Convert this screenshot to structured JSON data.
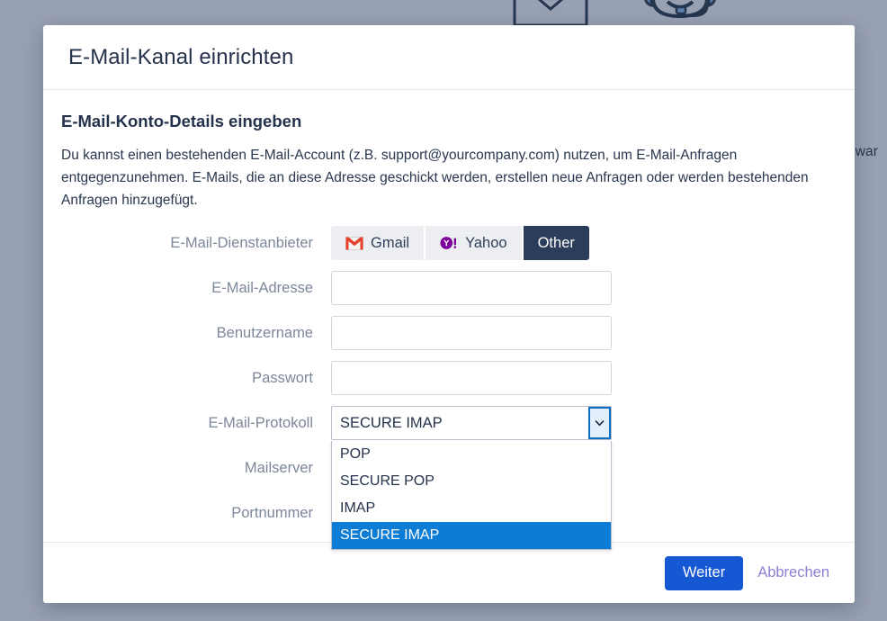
{
  "backdrop": {
    "clipped_text": "nwar",
    "decorations": [
      {
        "name": "envelope-illustration"
      },
      {
        "name": "support-agent-illustration"
      }
    ]
  },
  "modal": {
    "title": "E-Mail-Kanal einrichten",
    "section_heading": "E-Mail-Konto-Details eingeben",
    "intro_text": "Du kannst einen bestehenden E-Mail-Account (z.B. support@yourcompany.com) nutzen, um E-Mail-Anfragen entgegenzunehmen. E-Mails, die an diese Adresse geschickt werden, erstellen neue Anfragen oder werden bestehenden Anfragen hinzugefügt.",
    "form": {
      "provider": {
        "label": "E-Mail-Dienstanbieter",
        "options": [
          {
            "label": "Gmail",
            "icon": "gmail-icon",
            "selected": false
          },
          {
            "label": "Yahoo",
            "icon": "yahoo-icon",
            "selected": false
          },
          {
            "label": "Other",
            "icon": "",
            "selected": true
          }
        ]
      },
      "email": {
        "label": "E-Mail-Adresse",
        "value": "",
        "placeholder": ""
      },
      "username": {
        "label": "Benutzername",
        "value": "",
        "placeholder": ""
      },
      "password": {
        "label": "Passwort",
        "value": "",
        "placeholder": ""
      },
      "protocol": {
        "label": "E-Mail-Protokoll",
        "selected": "SECURE IMAP",
        "expanded": true,
        "options": [
          {
            "label": "POP",
            "highlighted": false
          },
          {
            "label": "SECURE POP",
            "highlighted": false
          },
          {
            "label": "IMAP",
            "highlighted": false
          },
          {
            "label": "SECURE IMAP",
            "highlighted": true
          }
        ]
      },
      "mailserver": {
        "label": "Mailserver",
        "value": "",
        "placeholder": ""
      },
      "port": {
        "label": "Portnummer",
        "value": "",
        "placeholder": ""
      }
    },
    "footer": {
      "primary_label": "Weiter",
      "cancel_label": "Abbrechen"
    }
  },
  "colors": {
    "backdrop": "#98a0b3",
    "modal_bg": "#ffffff",
    "title_text": "#25324b",
    "label_text": "#7d879a",
    "selected_provider_bg": "#2c3c5b",
    "provider_bg": "#eceef2",
    "dropdown_highlight": "#0c7cd5",
    "primary_button": "#1658d3",
    "cancel_link": "#8b7fd4",
    "select_arrow_border": "#0a6fc2"
  }
}
